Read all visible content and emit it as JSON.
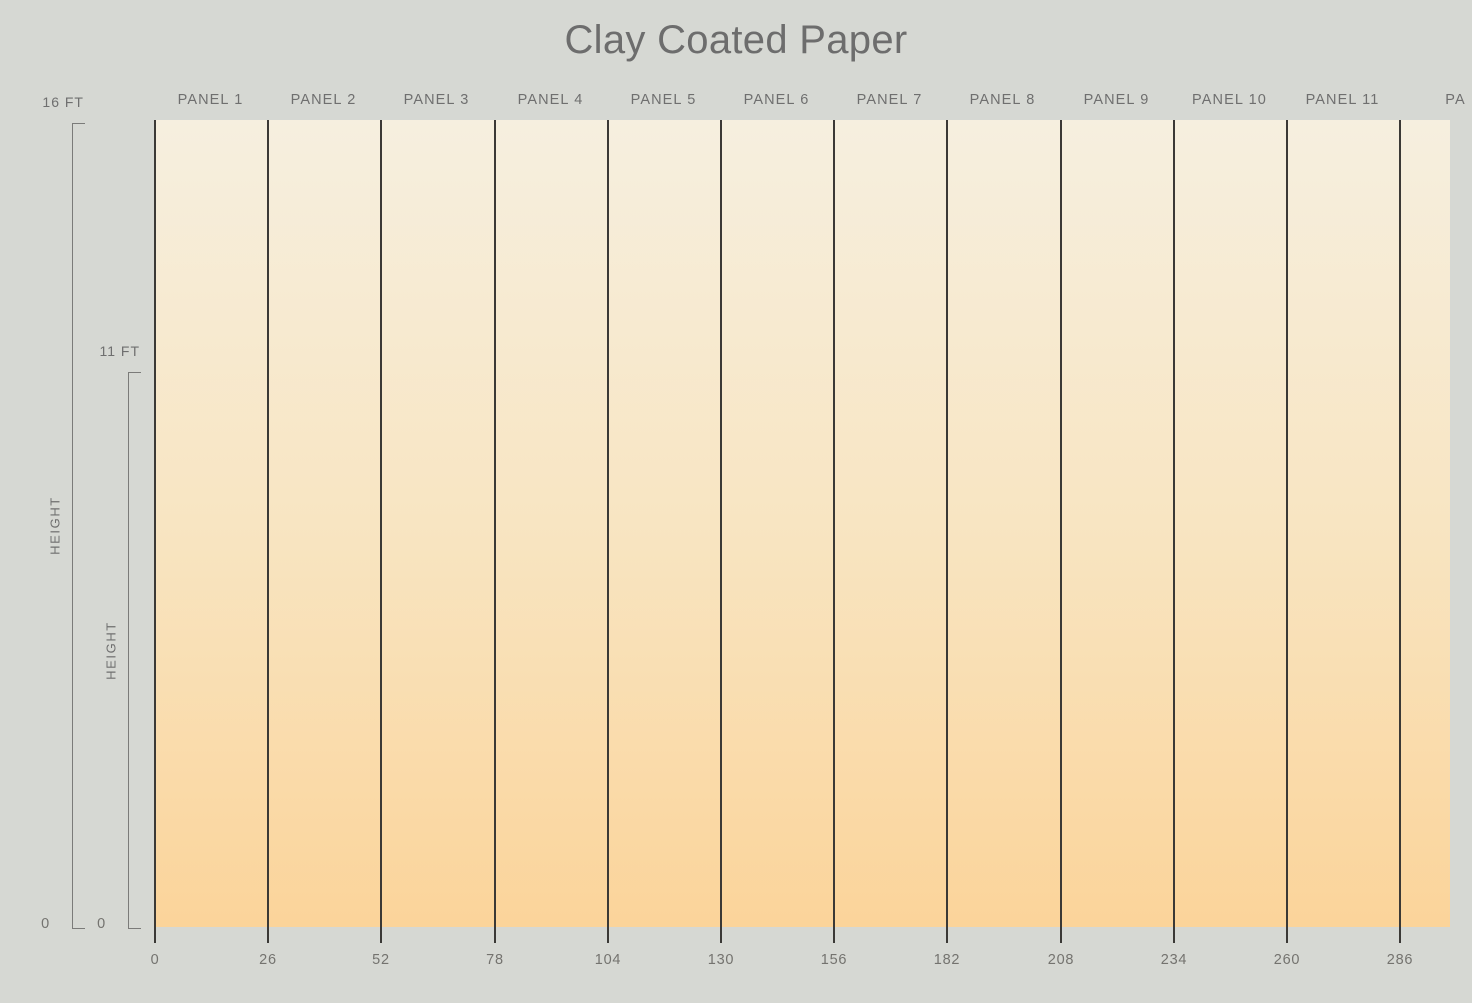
{
  "title": "Clay Coated Paper",
  "colors": {
    "background": "#d6d8d3",
    "gradient_top": "#f6efdf",
    "gradient_mid": "#f8e5c2",
    "gradient_bottom": "#fbd49a",
    "divider": "#3b3936",
    "axis_line": "#7b7b79",
    "label_text": "#6f6f6f",
    "tick_text": "#74736f",
    "title_text": "#6d6d6d"
  },
  "axes": {
    "y_outer": {
      "name": "HEIGHT",
      "max_label": "16 FT",
      "min_label": "0"
    },
    "y_inner": {
      "name": "HEIGHT",
      "max_label": "11 FT",
      "min_label": "0"
    },
    "x": {
      "tick_labels": [
        "0",
        "26",
        "52",
        "78",
        "104",
        "130",
        "156",
        "182",
        "208",
        "234",
        "260",
        "286"
      ]
    }
  },
  "panels": [
    {
      "label": "PANEL 1"
    },
    {
      "label": "PANEL 2"
    },
    {
      "label": "PANEL 3"
    },
    {
      "label": "PANEL 4"
    },
    {
      "label": "PANEL 5"
    },
    {
      "label": "PANEL 6"
    },
    {
      "label": "PANEL 7"
    },
    {
      "label": "PANEL 8"
    },
    {
      "label": "PANEL 9"
    },
    {
      "label": "PANEL 10"
    },
    {
      "label": "PANEL 11"
    },
    {
      "label": "PA"
    }
  ],
  "chart_data": {
    "type": "area",
    "title": "Clay Coated Paper",
    "xlabel": "",
    "ylabel": "HEIGHT",
    "grid": false,
    "legend": "none",
    "x": [
      0,
      26,
      52,
      78,
      104,
      130,
      156,
      182,
      208,
      234,
      260,
      286
    ],
    "xlim": [
      0,
      298
    ],
    "x_tick_step": 26,
    "x_tick_labels": [
      "0",
      "26",
      "52",
      "78",
      "104",
      "130",
      "156",
      "182",
      "208",
      "234",
      "260",
      "286"
    ],
    "y_axes": [
      {
        "name": "HEIGHT",
        "min": 0,
        "max": 16,
        "min_label": "0",
        "max_label": "16 FT",
        "unit": "FT"
      },
      {
        "name": "HEIGHT",
        "min": 0,
        "max": 11,
        "min_label": "0",
        "max_label": "11 FT",
        "unit": "FT"
      }
    ],
    "ylim": [
      0,
      16
    ],
    "categories": [
      "PANEL 1",
      "PANEL 2",
      "PANEL 3",
      "PANEL 4",
      "PANEL 5",
      "PANEL 6",
      "PANEL 7",
      "PANEL 8",
      "PANEL 9",
      "PANEL 10",
      "PANEL 11",
      "PA"
    ],
    "series": [
      {
        "name": "Clay Coated Paper",
        "values": [
          16,
          16,
          16,
          16,
          16,
          16,
          16,
          16,
          16,
          16,
          16,
          16
        ],
        "fill": "vertical-gradient",
        "fill_stops": [
          {
            "offset": 0,
            "color": "#f6efdf"
          },
          {
            "offset": 0.5,
            "color": "#f8e5c2"
          },
          {
            "offset": 1,
            "color": "#fbd49a"
          }
        ]
      }
    ],
    "annotations": [
      {
        "kind": "panel-divider",
        "count": 12,
        "width_in": 26,
        "color": "#3b3936"
      }
    ]
  }
}
